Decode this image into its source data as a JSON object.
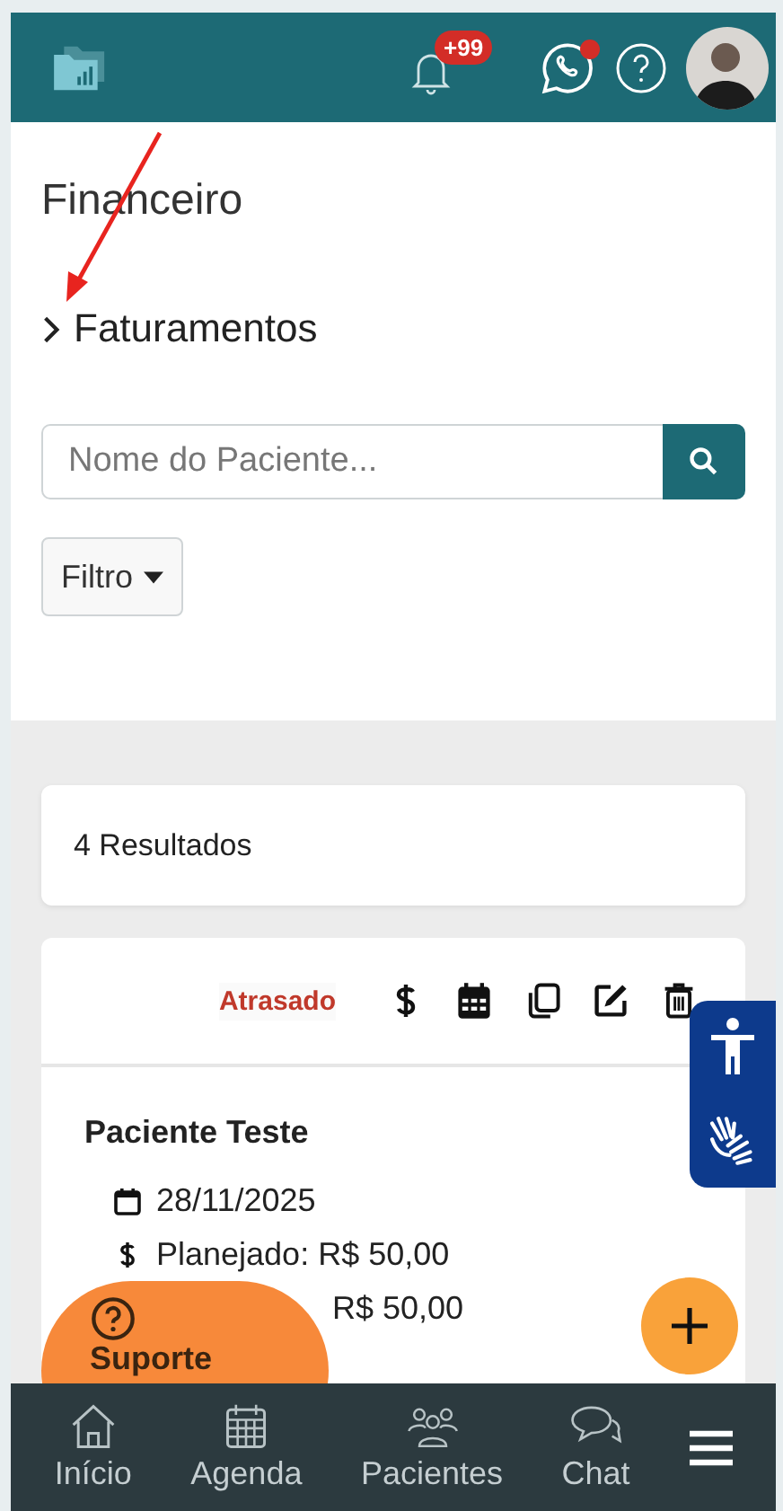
{
  "header": {
    "notification_count": "+99",
    "whatsapp_unread": true
  },
  "page": {
    "title": "Financeiro",
    "breadcrumb": "Faturamentos"
  },
  "search": {
    "placeholder": "Nome do Paciente..."
  },
  "filter": {
    "label": "Filtro"
  },
  "results": {
    "count": "4 Resultados"
  },
  "billing": {
    "status": "Atrasado",
    "patient": "Paciente Teste",
    "date": "28/11/2025",
    "planned": "Planejado: R$ 50,00",
    "received_value": "R$ 50,00"
  },
  "support": {
    "label": "Suporte"
  },
  "nav": [
    {
      "kind": "home",
      "label": "Início"
    },
    {
      "kind": "calendar",
      "label": "Agenda"
    },
    {
      "kind": "people",
      "label": "Pacientes"
    },
    {
      "kind": "chat",
      "label": "Chat"
    },
    {
      "kind": "menu"
    }
  ]
}
